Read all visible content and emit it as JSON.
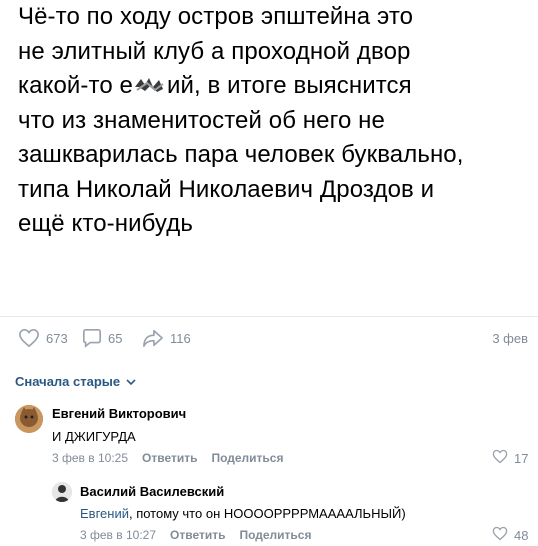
{
  "post": {
    "lines": [
      "Чё-то по ходу остров эпштейна это",
      "не элитный клуб а проходной двор",
      "какой-то е",
      "ий, в итоге выяснится",
      "что из знаменитостей об него не",
      "зашкварилась пара человек буквально,",
      "типа Николай Николаевич Дроздов и",
      "ещё кто-нибудь"
    ],
    "likes": "673",
    "comments": "65",
    "shares": "116",
    "date": "3 фев"
  },
  "sort_label": "Сначала старые",
  "comments": [
    {
      "author": "Евгений Викторович",
      "text": "И ДЖИГУРДА",
      "date": "3 фев в 10:25",
      "reply_label": "Ответить",
      "share_label": "Поделиться",
      "likes": "17"
    },
    {
      "author": "Василий Василевский",
      "mention": "Евгений",
      "text": ", потому что он НООООРРРРМААААЛЬНЫЙ)",
      "date": "3 фев в 10:27",
      "reply_label": "Ответить",
      "share_label": "Поделиться",
      "likes": "48"
    }
  ],
  "colors": {
    "link": "#2a5885",
    "muted": "#818c99",
    "divider": "#e7e8ec"
  }
}
